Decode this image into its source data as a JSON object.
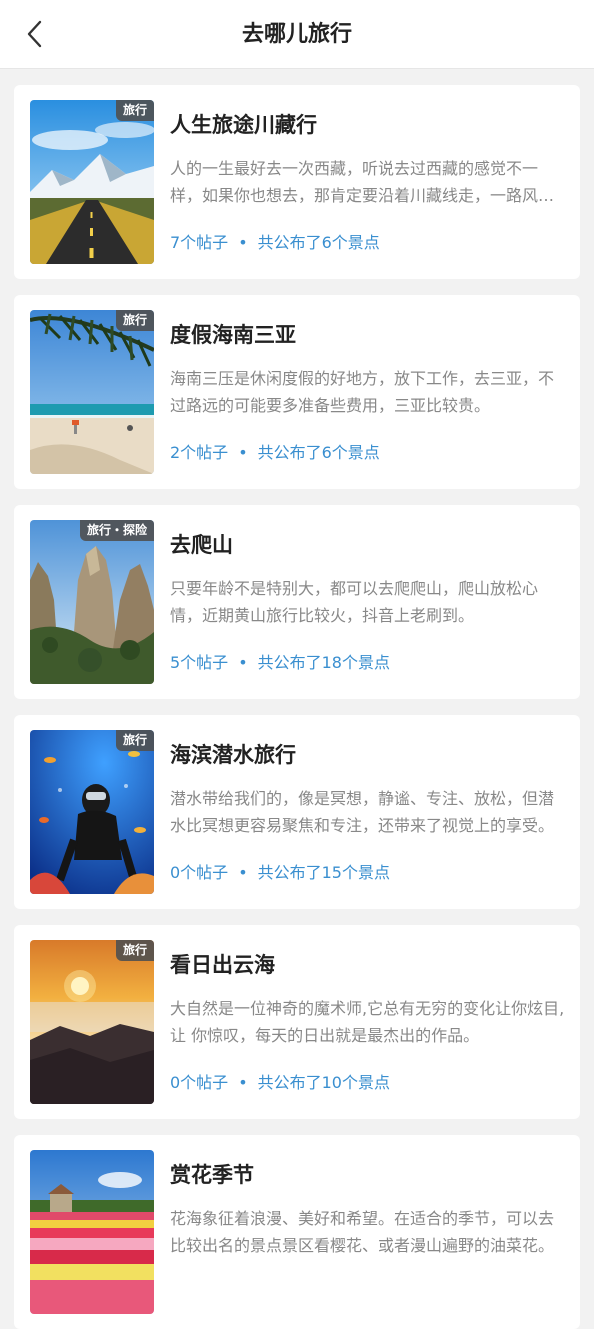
{
  "header": {
    "title": "去哪儿旅行"
  },
  "cards": [
    {
      "tag": "旅行",
      "title": "人生旅途川藏行",
      "desc": "人的一生最好去一次西藏，听说去过西藏的感觉不一样，如果你也想去，那肯定要沿着川藏线走，一路风景无数。",
      "posts": "7个帖子",
      "dot": "•",
      "spots": "共公布了6个景点"
    },
    {
      "tag": "旅行",
      "title": "度假海南三亚",
      "desc": "海南三压是休闲度假的好地方，放下工作，去三亚，不过路远的可能要多准备些费用，三亚比较贵。",
      "posts": "2个帖子",
      "dot": "•",
      "spots": "共公布了6个景点"
    },
    {
      "tag": "旅行・探险",
      "title": "去爬山",
      "desc": "只要年龄不是特别大，都可以去爬爬山，爬山放松心情，近期黄山旅行比较火，抖音上老刷到。",
      "posts": "5个帖子",
      "dot": "•",
      "spots": "共公布了18个景点"
    },
    {
      "tag": "旅行",
      "title": "海滨潜水旅行",
      "desc": "潜水带给我们的，像是冥想，静谧、专注、放松，但潜水比冥想更容易聚焦和专注，还带来了视觉上的享受。",
      "posts": "0个帖子",
      "dot": "•",
      "spots": "共公布了15个景点"
    },
    {
      "tag": "旅行",
      "title": "看日出云海",
      "desc": "大自然是一位神奇的魔术师,它总有无穷的变化让你炫目,让 你惊叹，每天的日出就是最杰出的作品。",
      "posts": "0个帖子",
      "dot": "•",
      "spots": "共公布了10个景点"
    },
    {
      "tag": "",
      "title": "赏花季节",
      "desc": "花海象征着浪漫、美好和希望。在适合的季节，可以去比较出名的景点景区看樱花、或者漫山遍野的油菜花。",
      "posts": "",
      "dot": "",
      "spots": ""
    }
  ]
}
